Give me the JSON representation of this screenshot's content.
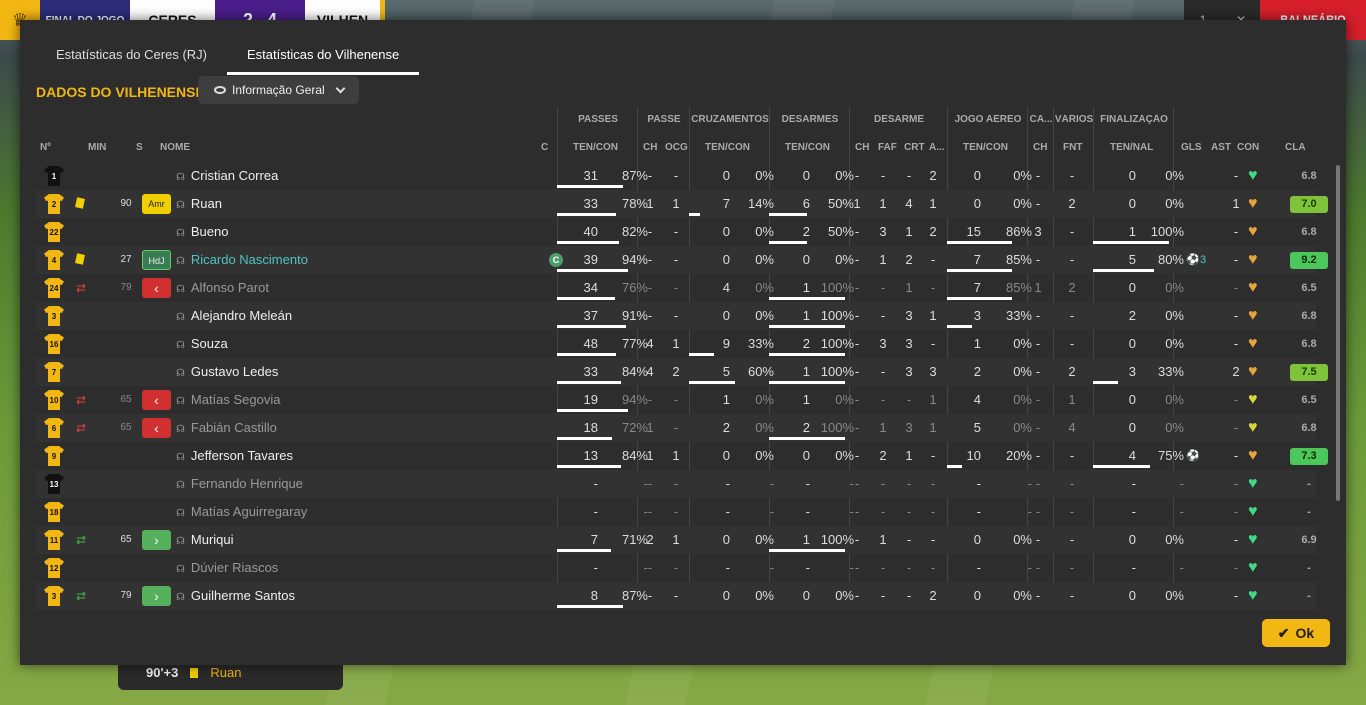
{
  "scorebar": {
    "label": "FINAL DO JOGO",
    "home": "CERES",
    "score_home": "2",
    "score_away": "4",
    "away": "VILHEN"
  },
  "topright": {
    "btn1": "1",
    "btn2": "✕",
    "red_label": "BALNEÁRIO"
  },
  "events": {
    "time": "90'+3",
    "name": "Ruan"
  },
  "tabs": [
    "Estatísticas do Ceres (RJ)",
    "Estatísticas do Vilhenense"
  ],
  "section_title": "DADOS DO VILHENENSE",
  "dropdown": {
    "label": "Informação Geral"
  },
  "group_headers": [
    "PASSES",
    "PASSE",
    "CRUZAMENTOS",
    "DESARMES",
    "DESARME",
    "JOGO AÉREO",
    "CA...",
    "VÁRIOS",
    "FINALIZAÇÃO"
  ],
  "col_headers": {
    "no": "Nº",
    "min": "MIN",
    "s": "S",
    "nome": "NOME",
    "c": "C",
    "pass_tc": "TEN/CON",
    "pass_ch": "CH",
    "pass_ocg": "OCG",
    "cruz": "TEN/CON",
    "des": "TEN/CON",
    "d_ch": "CH",
    "d_faf": "FAF",
    "d_crt": "CRT",
    "d_a": "A...",
    "aereo": "TEN/CON",
    "ca_ch": "CH",
    "fnt": "FNT",
    "fin": "TEN/NAL",
    "gls": "GLS",
    "ast": "AST",
    "con": "CON",
    "cla": "CLA"
  },
  "players": [
    {
      "no": "1",
      "gk": true,
      "card": "",
      "sub": "",
      "min": "",
      "badge": "",
      "name": "Cristian Correa",
      "state": "on",
      "cap": "",
      "pass_t": "31",
      "pass_p": "87%",
      "pass_f": 0.87,
      "ch": "-",
      "ocg": "-",
      "cr_t": "0",
      "cr_p": "0%",
      "cr_f": 0,
      "de_t": "0",
      "de_p": "0%",
      "de_f": 0,
      "dch": "-",
      "faf": "-",
      "crt": "-",
      "da": "2",
      "ae_t": "0",
      "ae_p": "0%",
      "ae_f": 0,
      "cach": "-",
      "fnt": "-",
      "fi_t": "0",
      "fi_p": "0%",
      "fi_f": 0,
      "gls": "",
      "gls_n": "",
      "ast": "-",
      "heart": "g",
      "cla": "6.8",
      "cla_c": ""
    },
    {
      "no": "2",
      "gk": false,
      "card": "y",
      "sub": "",
      "min": "90",
      "badge": "Amr",
      "name": "Ruan",
      "state": "on",
      "cap": "",
      "pass_t": "33",
      "pass_p": "78%",
      "pass_f": 0.78,
      "ch": "1",
      "ocg": "1",
      "cr_t": "7",
      "cr_p": "14%",
      "cr_f": 0.14,
      "de_t": "6",
      "de_p": "50%",
      "de_f": 0.5,
      "dch": "1",
      "faf": "1",
      "crt": "4",
      "da": "1",
      "ae_t": "0",
      "ae_p": "0%",
      "ae_f": 0,
      "cach": "-",
      "fnt": "2",
      "fi_t": "0",
      "fi_p": "0%",
      "fi_f": 0,
      "gls": "",
      "gls_n": "",
      "ast": "1",
      "heart": "o",
      "cla": "7.0",
      "cla_c": "g"
    },
    {
      "no": "22",
      "gk": false,
      "card": "",
      "sub": "",
      "min": "",
      "badge": "",
      "name": "Bueno",
      "state": "on",
      "cap": "",
      "pass_t": "40",
      "pass_p": "82%",
      "pass_f": 0.82,
      "ch": "-",
      "ocg": "-",
      "cr_t": "0",
      "cr_p": "0%",
      "cr_f": 0,
      "de_t": "2",
      "de_p": "50%",
      "de_f": 0.5,
      "dch": "-",
      "faf": "3",
      "crt": "1",
      "da": "2",
      "ae_t": "15",
      "ae_p": "86%",
      "ae_f": 0.86,
      "cach": "3",
      "fnt": "-",
      "fi_t": "1",
      "fi_p": "100%",
      "fi_f": 1,
      "gls": "",
      "gls_n": "",
      "ast": "-",
      "heart": "o",
      "cla": "6.8",
      "cla_c": ""
    },
    {
      "no": "4",
      "gk": false,
      "card": "y",
      "sub": "",
      "min": "27",
      "badge": "HdJ",
      "name": "Ricardo Nascimento",
      "state": "hl",
      "cap": "C",
      "pass_t": "39",
      "pass_p": "94%",
      "pass_f": 0.94,
      "ch": "-",
      "ocg": "-",
      "cr_t": "0",
      "cr_p": "0%",
      "cr_f": 0,
      "de_t": "0",
      "de_p": "0%",
      "de_f": 0,
      "dch": "-",
      "faf": "1",
      "crt": "2",
      "da": "-",
      "ae_t": "7",
      "ae_p": "85%",
      "ae_f": 0.85,
      "cach": "-",
      "fnt": "-",
      "fi_t": "5",
      "fi_p": "80%",
      "fi_f": 0.8,
      "gls": "ball",
      "gls_n": "3",
      "ast": "-",
      "heart": "o",
      "cla": "9.2",
      "cla_c": "gg"
    },
    {
      "no": "24",
      "gk": false,
      "card": "",
      "sub": "out",
      "min": "79",
      "badge": "out",
      "name": "Alfonso Parot",
      "state": "off",
      "cap": "",
      "pass_t": "34",
      "pass_p": "76%",
      "pass_f": 0.76,
      "ch": "-",
      "ocg": "-",
      "cr_t": "4",
      "cr_p": "0%",
      "cr_f": 0,
      "de_t": "1",
      "de_p": "100%",
      "de_f": 1,
      "dch": "-",
      "faf": "-",
      "crt": "1",
      "da": "-",
      "ae_t": "7",
      "ae_p": "85%",
      "ae_f": 0.85,
      "cach": "1",
      "fnt": "2",
      "fi_t": "0",
      "fi_p": "0%",
      "fi_f": 0,
      "gls": "",
      "gls_n": "",
      "ast": "-",
      "heart": "o",
      "cla": "6.5",
      "cla_c": ""
    },
    {
      "no": "3",
      "gk": false,
      "card": "",
      "sub": "",
      "min": "",
      "badge": "",
      "name": "Alejandro Meleán",
      "state": "on",
      "cap": "",
      "pass_t": "37",
      "pass_p": "91%",
      "pass_f": 0.91,
      "ch": "-",
      "ocg": "-",
      "cr_t": "0",
      "cr_p": "0%",
      "cr_f": 0,
      "de_t": "1",
      "de_p": "100%",
      "de_f": 1,
      "dch": "-",
      "faf": "-",
      "crt": "3",
      "da": "1",
      "ae_t": "3",
      "ae_p": "33%",
      "ae_f": 0.33,
      "cach": "-",
      "fnt": "-",
      "fi_t": "2",
      "fi_p": "0%",
      "fi_f": 0,
      "gls": "",
      "gls_n": "",
      "ast": "-",
      "heart": "o",
      "cla": "6.8",
      "cla_c": ""
    },
    {
      "no": "16",
      "gk": false,
      "card": "",
      "sub": "",
      "min": "",
      "badge": "",
      "name": "Souza",
      "state": "on",
      "cap": "",
      "pass_t": "48",
      "pass_p": "77%",
      "pass_f": 0.77,
      "ch": "4",
      "ocg": "1",
      "cr_t": "9",
      "cr_p": "33%",
      "cr_f": 0.33,
      "de_t": "2",
      "de_p": "100%",
      "de_f": 1,
      "dch": "-",
      "faf": "3",
      "crt": "3",
      "da": "-",
      "ae_t": "1",
      "ae_p": "0%",
      "ae_f": 0,
      "cach": "-",
      "fnt": "-",
      "fi_t": "0",
      "fi_p": "0%",
      "fi_f": 0,
      "gls": "",
      "gls_n": "",
      "ast": "-",
      "heart": "o",
      "cla": "6.8",
      "cla_c": ""
    },
    {
      "no": "7",
      "gk": false,
      "card": "",
      "sub": "",
      "min": "",
      "badge": "",
      "name": "Gustavo Ledes",
      "state": "on",
      "cap": "",
      "pass_t": "33",
      "pass_p": "84%",
      "pass_f": 0.84,
      "ch": "4",
      "ocg": "2",
      "cr_t": "5",
      "cr_p": "60%",
      "cr_f": 0.6,
      "de_t": "1",
      "de_p": "100%",
      "de_f": 1,
      "dch": "-",
      "faf": "-",
      "crt": "3",
      "da": "3",
      "ae_t": "2",
      "ae_p": "0%",
      "ae_f": 0,
      "cach": "-",
      "fnt": "2",
      "fi_t": "3",
      "fi_p": "33%",
      "fi_f": 0.33,
      "gls": "",
      "gls_n": "",
      "ast": "2",
      "heart": "o",
      "cla": "7.5",
      "cla_c": "g"
    },
    {
      "no": "10",
      "gk": false,
      "card": "",
      "sub": "out",
      "min": "65",
      "badge": "out",
      "name": "Matías Segovia",
      "state": "off",
      "cap": "",
      "pass_t": "19",
      "pass_p": "94%",
      "pass_f": 0.94,
      "ch": "-",
      "ocg": "-",
      "cr_t": "1",
      "cr_p": "0%",
      "cr_f": 0,
      "de_t": "1",
      "de_p": "0%",
      "de_f": 0,
      "dch": "-",
      "faf": "-",
      "crt": "-",
      "da": "1",
      "ae_t": "4",
      "ae_p": "0%",
      "ae_f": 0,
      "cach": "-",
      "fnt": "1",
      "fi_t": "0",
      "fi_p": "0%",
      "fi_f": 0,
      "gls": "",
      "gls_n": "",
      "ast": "-",
      "heart": "y",
      "cla": "6.5",
      "cla_c": ""
    },
    {
      "no": "6",
      "gk": false,
      "card": "",
      "sub": "out",
      "min": "65",
      "badge": "out",
      "name": "Fabián Castillo",
      "state": "off",
      "cap": "",
      "pass_t": "18",
      "pass_p": "72%",
      "pass_f": 0.72,
      "ch": "1",
      "ocg": "-",
      "cr_t": "2",
      "cr_p": "0%",
      "cr_f": 0,
      "de_t": "2",
      "de_p": "100%",
      "de_f": 1,
      "dch": "-",
      "faf": "1",
      "crt": "3",
      "da": "1",
      "ae_t": "5",
      "ae_p": "0%",
      "ae_f": 0,
      "cach": "-",
      "fnt": "4",
      "fi_t": "0",
      "fi_p": "0%",
      "fi_f": 0,
      "gls": "",
      "gls_n": "",
      "ast": "-",
      "heart": "y",
      "cla": "6.8",
      "cla_c": ""
    },
    {
      "no": "9",
      "gk": false,
      "card": "",
      "sub": "",
      "min": "",
      "badge": "",
      "name": "Jefferson Tavares",
      "state": "on",
      "cap": "",
      "pass_t": "13",
      "pass_p": "84%",
      "pass_f": 0.84,
      "ch": "1",
      "ocg": "1",
      "cr_t": "0",
      "cr_p": "0%",
      "cr_f": 0,
      "de_t": "0",
      "de_p": "0%",
      "de_f": 0,
      "dch": "-",
      "faf": "2",
      "crt": "1",
      "da": "-",
      "ae_t": "10",
      "ae_p": "20%",
      "ae_f": 0.2,
      "cach": "-",
      "fnt": "-",
      "fi_t": "4",
      "fi_p": "75%",
      "fi_f": 0.75,
      "gls": "ball",
      "gls_n": "",
      "ast": "-",
      "heart": "o",
      "cla": "7.3",
      "cla_c": "gg"
    },
    {
      "no": "13",
      "gk": true,
      "card": "",
      "sub": "",
      "min": "",
      "badge": "",
      "name": "Fernando Henrique",
      "state": "off",
      "cap": "",
      "pass_t": "-",
      "pass_p": "-",
      "pass_f": 0,
      "ch": "-",
      "ocg": "-",
      "cr_t": "-",
      "cr_p": "-",
      "cr_f": 0,
      "de_t": "-",
      "de_p": "-",
      "de_f": 0,
      "dch": "-",
      "faf": "-",
      "crt": "-",
      "da": "-",
      "ae_t": "-",
      "ae_p": "-",
      "ae_f": 0,
      "cach": "-",
      "fnt": "-",
      "fi_t": "-",
      "fi_p": "-",
      "fi_f": 0,
      "gls": "",
      "gls_n": "",
      "ast": "-",
      "heart": "g",
      "cla": "-",
      "cla_c": ""
    },
    {
      "no": "18",
      "gk": false,
      "card": "",
      "sub": "",
      "min": "",
      "badge": "",
      "name": "Matías Aguirregaray",
      "state": "off",
      "cap": "",
      "pass_t": "-",
      "pass_p": "-",
      "pass_f": 0,
      "ch": "-",
      "ocg": "-",
      "cr_t": "-",
      "cr_p": "-",
      "cr_f": 0,
      "de_t": "-",
      "de_p": "-",
      "de_f": 0,
      "dch": "-",
      "faf": "-",
      "crt": "-",
      "da": "-",
      "ae_t": "-",
      "ae_p": "-",
      "ae_f": 0,
      "cach": "-",
      "fnt": "-",
      "fi_t": "-",
      "fi_p": "-",
      "fi_f": 0,
      "gls": "",
      "gls_n": "",
      "ast": "-",
      "heart": "g",
      "cla": "-",
      "cla_c": ""
    },
    {
      "no": "11",
      "gk": false,
      "card": "",
      "sub": "in",
      "min": "65",
      "badge": "in",
      "name": "Muriqui",
      "state": "on",
      "cap": "",
      "pass_t": "7",
      "pass_p": "71%",
      "pass_f": 0.71,
      "ch": "2",
      "ocg": "1",
      "cr_t": "0",
      "cr_p": "0%",
      "cr_f": 0,
      "de_t": "1",
      "de_p": "100%",
      "de_f": 1,
      "dch": "-",
      "faf": "1",
      "crt": "-",
      "da": "-",
      "ae_t": "0",
      "ae_p": "0%",
      "ae_f": 0,
      "cach": "-",
      "fnt": "-",
      "fi_t": "0",
      "fi_p": "0%",
      "fi_f": 0,
      "gls": "",
      "gls_n": "",
      "ast": "-",
      "heart": "g",
      "cla": "6.9",
      "cla_c": ""
    },
    {
      "no": "12",
      "gk": false,
      "card": "",
      "sub": "",
      "min": "",
      "badge": "",
      "name": "Dúvier Riascos",
      "state": "off",
      "cap": "",
      "pass_t": "-",
      "pass_p": "-",
      "pass_f": 0,
      "ch": "-",
      "ocg": "-",
      "cr_t": "-",
      "cr_p": "-",
      "cr_f": 0,
      "de_t": "-",
      "de_p": "-",
      "de_f": 0,
      "dch": "-",
      "faf": "-",
      "crt": "-",
      "da": "-",
      "ae_t": "-",
      "ae_p": "-",
      "ae_f": 0,
      "cach": "-",
      "fnt": "-",
      "fi_t": "-",
      "fi_p": "-",
      "fi_f": 0,
      "gls": "",
      "gls_n": "",
      "ast": "-",
      "heart": "g",
      "cla": "-",
      "cla_c": ""
    },
    {
      "no": "3",
      "gk": false,
      "card": "",
      "sub": "in",
      "min": "79",
      "badge": "in",
      "name": "Guilherme Santos",
      "state": "on",
      "cap": "",
      "pass_t": "8",
      "pass_p": "87%",
      "pass_f": 0.87,
      "ch": "-",
      "ocg": "-",
      "cr_t": "0",
      "cr_p": "0%",
      "cr_f": 0,
      "de_t": "0",
      "de_p": "0%",
      "de_f": 0,
      "dch": "-",
      "faf": "-",
      "crt": "-",
      "da": "2",
      "ae_t": "0",
      "ae_p": "0%",
      "ae_f": 0,
      "cach": "-",
      "fnt": "-",
      "fi_t": "0",
      "fi_p": "0%",
      "fi_f": 0,
      "gls": "",
      "gls_n": "",
      "ast": "-",
      "heart": "g",
      "cla": "-",
      "cla_c": ""
    }
  ],
  "ok_label": "Ok",
  "colors": {
    "accent": "#f3b713",
    "highlight": "#4fc3c3",
    "good": "#7ec33a"
  }
}
